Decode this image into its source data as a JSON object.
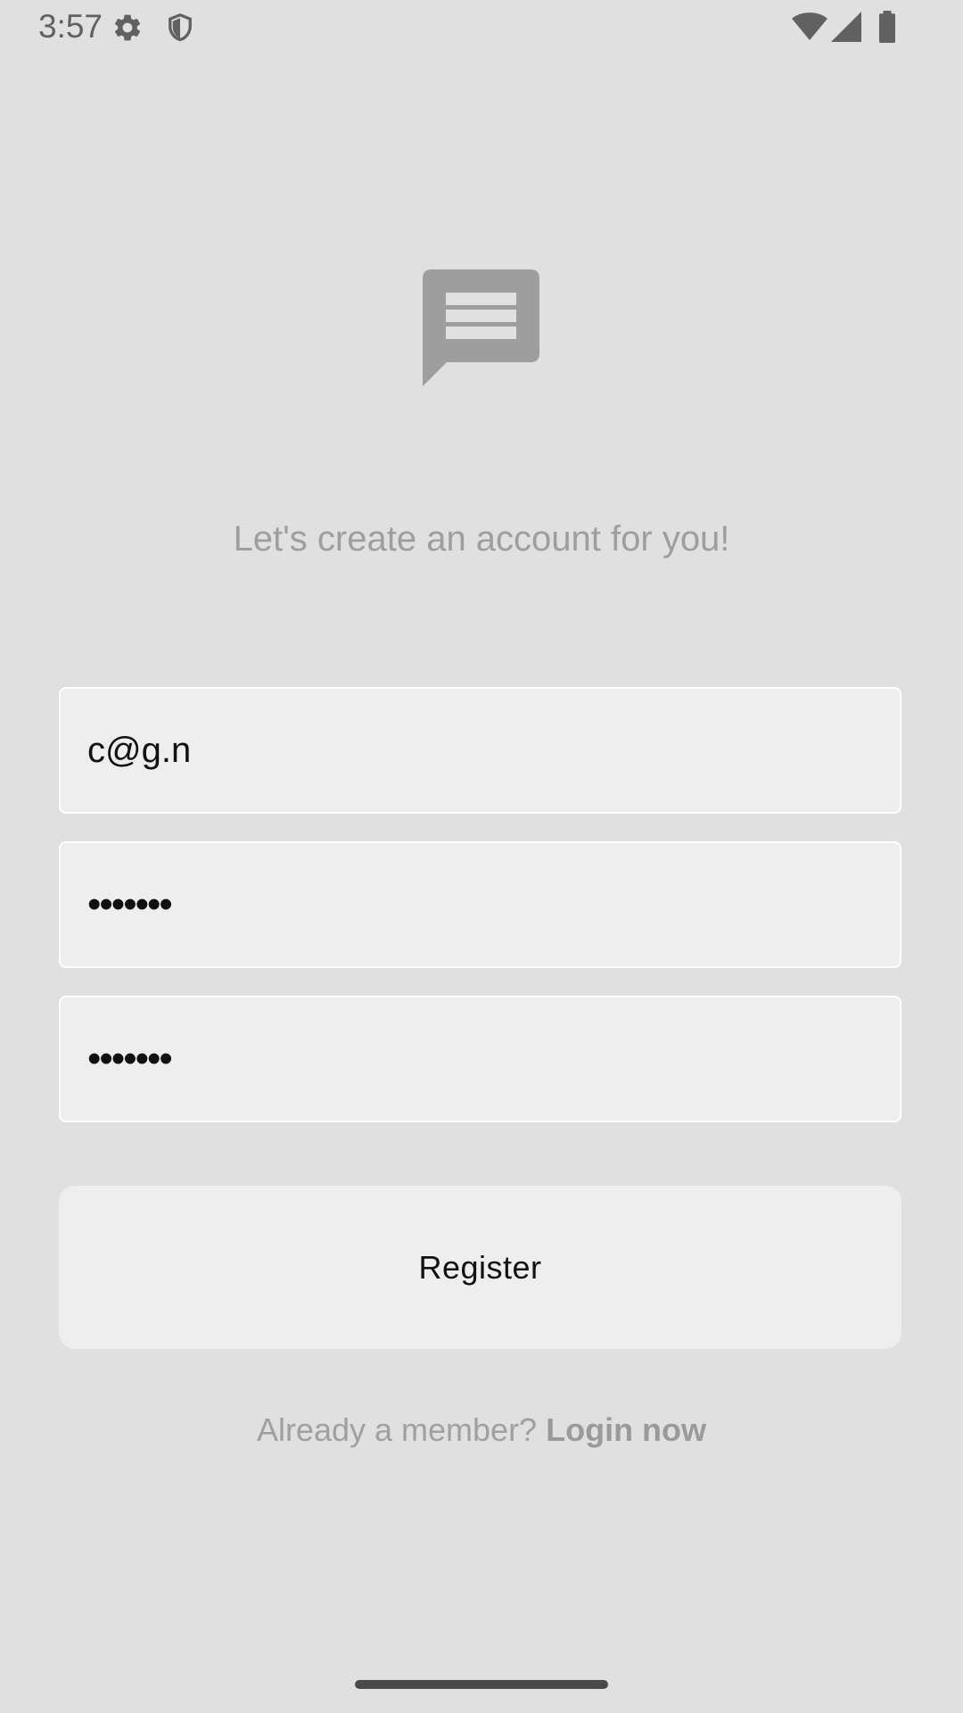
{
  "status_bar": {
    "time": "3:57",
    "icons": [
      "gear-icon",
      "shield-icon",
      "wifi-icon",
      "signal-icon",
      "battery-icon"
    ]
  },
  "logo": {
    "icon": "message-icon",
    "color": "#9e9e9e"
  },
  "tagline": "Let's create an account for you!",
  "form": {
    "email_value": "c@g.n",
    "password_value": "•••••••",
    "confirm_password_value": "•••••••",
    "register_label": "Register"
  },
  "footer": {
    "prompt": "Already a member?",
    "login_label": "Login now"
  },
  "colors": {
    "background": "#e0e0e0",
    "field": "#eeeeee",
    "muted_text": "#9e9e9e"
  }
}
